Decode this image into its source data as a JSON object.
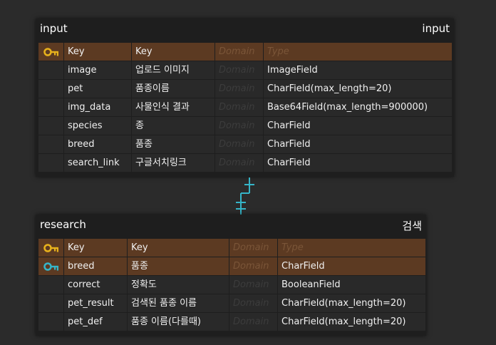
{
  "entities": {
    "input": {
      "logical_name": "input",
      "physical_name": "input",
      "header": {
        "logical": "Key",
        "physical": "Key",
        "domain": "Domain",
        "type": "Type"
      },
      "rows": [
        {
          "logical": "image",
          "physical": "업로드 이미지",
          "domain": "Domain",
          "type": "ImageField"
        },
        {
          "logical": "pet",
          "physical": "품종이름",
          "domain": "Domain",
          "type": "CharField(max_length=20)"
        },
        {
          "logical": "img_data",
          "physical": "사물인식 결과",
          "domain": "Domain",
          "type": "Base64Field(max_length=900000)"
        },
        {
          "logical": "species",
          "physical": "종",
          "domain": "Domain",
          "type": "CharField"
        },
        {
          "logical": "breed",
          "physical": "품종",
          "domain": "Domain",
          "type": "CharField"
        },
        {
          "logical": "search_link",
          "physical": "구글서치링크",
          "domain": "Domain",
          "type": "CharField"
        }
      ]
    },
    "research": {
      "logical_name": "research",
      "physical_name": "검색",
      "header": {
        "logical": "Key",
        "physical": "Key",
        "domain": "Domain",
        "type": "Type"
      },
      "rows": [
        {
          "logical": "breed",
          "physical": "품종",
          "domain": "Domain",
          "type": "CharField"
        },
        {
          "logical": "correct",
          "physical": "정확도",
          "domain": "Domain",
          "type": "BooleanField"
        },
        {
          "logical": "pet_result",
          "physical": "검색된 품종 이름",
          "domain": "Domain",
          "type": "CharField(max_length=20)"
        },
        {
          "logical": "pet_def",
          "physical": "품종 이름(다를때)",
          "domain": "Domain",
          "type": "CharField(max_length=20)"
        }
      ]
    }
  },
  "colors": {
    "background": "#2b2b2b",
    "entity": "#1e1e1e",
    "cell": "#292929",
    "key_row": "#5c3a22",
    "primary_key_icon": "#e8b21c",
    "foreign_key_icon": "#35b5c8",
    "relationship_line": "#35b5c8"
  },
  "icons": {
    "primary_key": "gold-key-icon",
    "foreign_key": "teal-key-icon"
  }
}
